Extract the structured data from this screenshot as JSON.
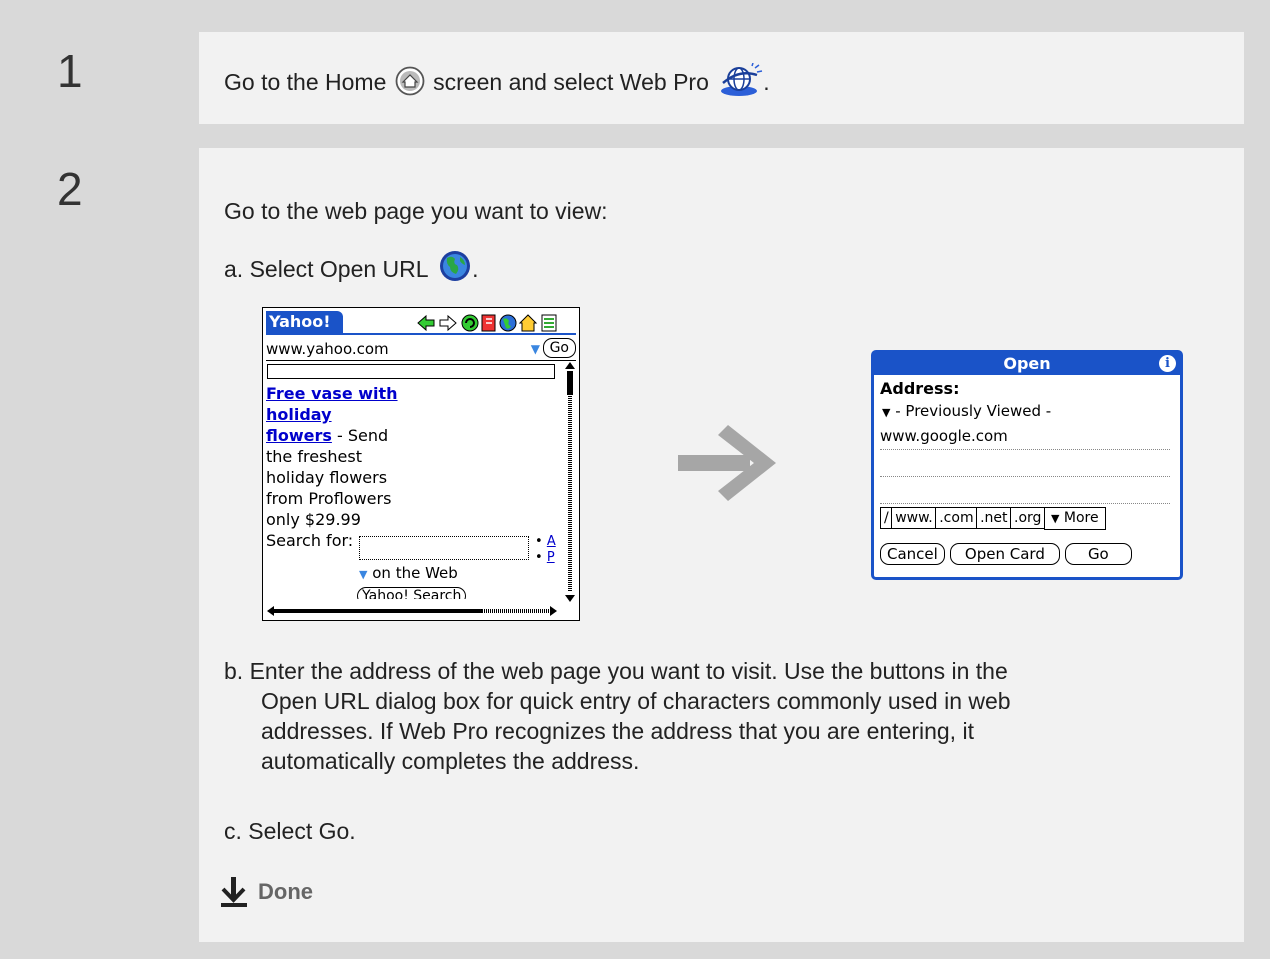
{
  "step1": {
    "number": "1",
    "text_before": "Go to the Home",
    "text_middle": "screen and select Web Pro",
    "text_after": ".",
    "home_icon": "home-icon",
    "webpro_icon": "web-pro-globe-icon"
  },
  "step2": {
    "number": "2",
    "intro": "Go to the web page you want to view:",
    "step_a": "a. Select Open URL",
    "step_a_end": ".",
    "open_url_icon": "open-url-globe-icon",
    "step_b_lines": [
      "b. Enter the address of the web page you want to visit. Use the buttons in the",
      "Open URL dialog box for quick entry of characters commonly used in web",
      "addresses. If Web Pro recognizes the address that you are entering, it",
      "automatically completes the address."
    ],
    "step_c": "c. Select Go.",
    "done": "Done"
  },
  "browser": {
    "title": "Yahoo!",
    "url": "www.yahoo.com",
    "go": "Go",
    "link_lines": [
      "Free vase with",
      "holiday",
      "flowers"
    ],
    "link_suffix": " - Send",
    "body_lines": [
      "the freshest",
      "holiday flowers",
      "from Proflowers",
      "only $29.99"
    ],
    "search_label": "Search for:",
    "side_links": [
      "A",
      "P"
    ],
    "search_scope": "on the Web",
    "search_button": "Yahoo! Search",
    "toolbar_icons": [
      "back-arrow-icon",
      "forward-arrow-icon",
      "refresh-icon",
      "bookmark-icon",
      "open-url-icon",
      "home-icon",
      "page-icon"
    ]
  },
  "dialog": {
    "title": "Open",
    "address_label": "Address:",
    "previously_viewed": "- Previously Viewed -",
    "address_value": "www.google.com",
    "keys": [
      "/",
      "www.",
      ".com",
      ".net",
      ".org"
    ],
    "more": "More",
    "buttons": [
      "Cancel",
      "Open Card",
      "Go"
    ]
  },
  "colors": {
    "accent_blue": "#1a53c8",
    "arrow_gray": "#a6a6a6"
  }
}
